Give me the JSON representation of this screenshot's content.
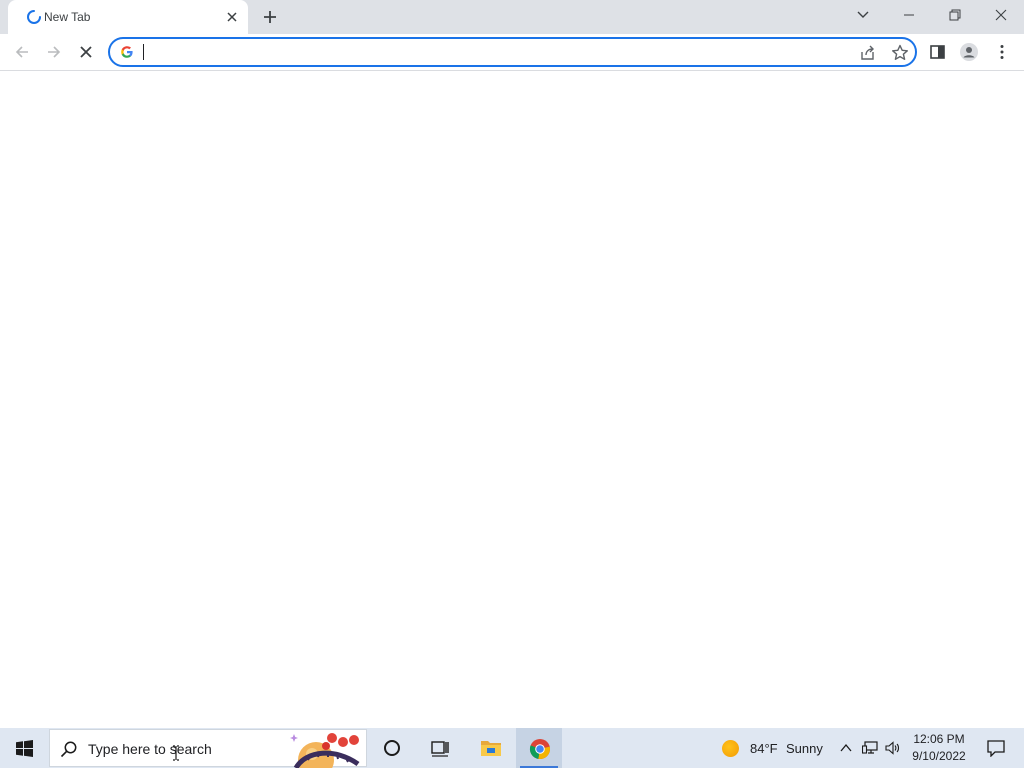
{
  "browser": {
    "tab": {
      "title": "New Tab"
    },
    "omnibox": {
      "value": "",
      "placeholder": ""
    }
  },
  "taskbar": {
    "search_placeholder": "Type here to search",
    "weather": {
      "temperature": "84°F",
      "condition": "Sunny"
    },
    "clock": {
      "time": "12:06 PM",
      "date": "9/10/2022"
    }
  },
  "colors": {
    "tab_strip": "#dee1e6",
    "omnibox_focus": "#1a73e8",
    "taskbar": "#dfe7f2",
    "taskbar_active": "#c6d3e4"
  },
  "icons": {
    "tab": [
      "loading-spinner-icon",
      "close-icon"
    ],
    "window": [
      "tab-search-icon",
      "minimize-icon",
      "restore-icon",
      "close-window-icon"
    ],
    "toolbar": [
      "back-icon",
      "forward-icon",
      "stop-icon",
      "google-icon",
      "share-icon",
      "bookmark-star-icon",
      "side-panel-icon",
      "profile-icon",
      "menu-icon"
    ],
    "taskbar": [
      "windows-start-icon",
      "search-icon",
      "cortana-icon",
      "task-view-icon",
      "file-explorer-icon",
      "chrome-icon",
      "sun-icon",
      "chevron-up-icon",
      "network-icon",
      "volume-icon",
      "notification-icon"
    ]
  }
}
